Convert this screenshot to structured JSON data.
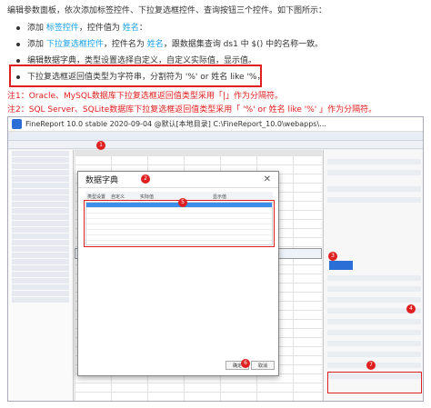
{
  "intro": "编辑参数面板，依次添加标签控件、下拉复选框控件、查询按钮三个控件。如下图所示：",
  "bullets": [
    {
      "before": "添加",
      "hl1": "标签控件",
      "mid": "，控件值为",
      "hl2": "姓名",
      "after": "："
    },
    {
      "before": "添加",
      "hl1": "下拉复选框控件",
      "mid": "，控件名为",
      "hl2": "姓名",
      "after": "，跟数据集查询 ds1 中 $() 中的名称一致。"
    },
    {
      "before": "编辑数据字典，类型设置选择自定义，自定义实际值，显示值。",
      "hl1": "",
      "mid": "",
      "hl2": "",
      "after": ""
    },
    {
      "before": "下拉复选框返回值类型为字符串，分割符为 '%' or 姓名 like '%，",
      "hl1": "",
      "mid": "",
      "hl2": "",
      "after": ""
    }
  ],
  "notes": [
    "注1：Oracle、MySQL数据库下拉复选框返回值类型采用「|」作为分隔符。",
    "注2：SQL Server、SQLite数据库下拉复选框返回值类型采用「 '%' or 姓名 like '%' 」作为分隔符。"
  ],
  "window": {
    "title": "FineReport 10.0 stable 2020-09-04 @默认[本地目录]    C:\\FineReport_10.0\\webapps\\..."
  },
  "dialog": {
    "title": "数据字典",
    "close": "✕",
    "col1": "类型设置",
    "col2": "自定义",
    "h1": "实际值",
    "h2": "显示值",
    "ok": "确定",
    "cancel": "取消"
  },
  "badges": [
    "1",
    "2",
    "3",
    "4",
    "5",
    "6",
    "7"
  ],
  "colors": {
    "accent": "#1aa0e8",
    "alert": "#e02020",
    "brand": "#2b6fd6"
  }
}
